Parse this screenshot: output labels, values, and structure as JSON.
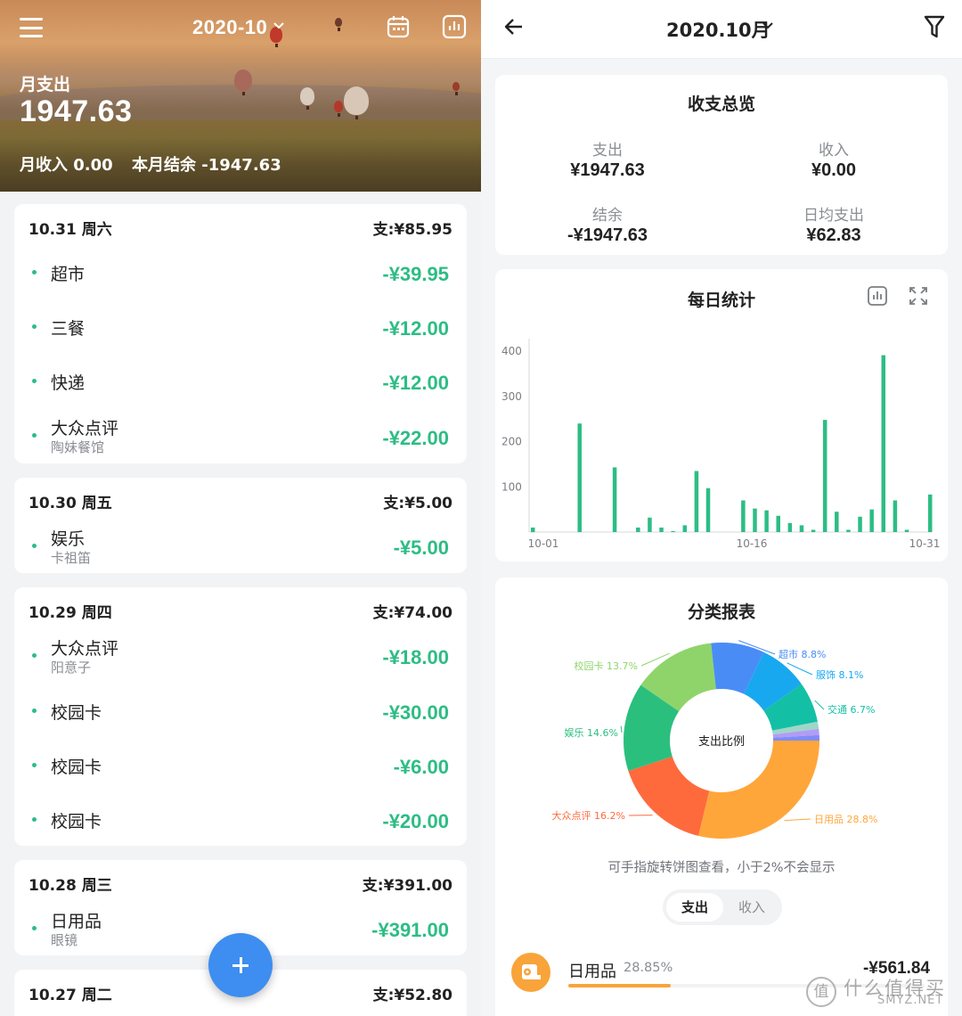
{
  "hero": {
    "month": "2020-10",
    "expense_label": "月支出",
    "expense_value": "1947.63",
    "income_text": "月收入 0.00",
    "balance_text": "本月结余 -1947.63"
  },
  "days": [
    {
      "date": "10.31 周六",
      "total": "支:¥85.95",
      "items": [
        {
          "name": "超市",
          "sub": "",
          "amount": "-¥39.95"
        },
        {
          "name": "三餐",
          "sub": "",
          "amount": "-¥12.00"
        },
        {
          "name": "快递",
          "sub": "",
          "amount": "-¥12.00"
        },
        {
          "name": "大众点评",
          "sub": "陶妹餐馆",
          "amount": "-¥22.00"
        }
      ]
    },
    {
      "date": "10.30 周五",
      "total": "支:¥5.00",
      "items": [
        {
          "name": "娱乐",
          "sub": "卡祖笛",
          "amount": "-¥5.00"
        }
      ]
    },
    {
      "date": "10.29 周四",
      "total": "支:¥74.00",
      "items": [
        {
          "name": "大众点评",
          "sub": "阳意子",
          "amount": "-¥18.00"
        },
        {
          "name": "校园卡",
          "sub": "",
          "amount": "-¥30.00"
        },
        {
          "name": "校园卡",
          "sub": "",
          "amount": "-¥6.00"
        },
        {
          "name": "校园卡",
          "sub": "",
          "amount": "-¥20.00"
        }
      ]
    },
    {
      "date": "10.28 周三",
      "total": "支:¥391.00",
      "items": [
        {
          "name": "日用品",
          "sub": "眼镜",
          "amount": "-¥391.00"
        }
      ]
    },
    {
      "date": "10.27 周二",
      "total": "支:¥52.80",
      "items": []
    }
  ],
  "right": {
    "title": "2020.10月",
    "overview": {
      "title": "收支总览",
      "expense_label": "支出",
      "expense_value": "¥1947.63",
      "income_label": "收入",
      "income_value": "¥0.00",
      "balance_label": "结余",
      "balance_value": "-¥1947.63",
      "daily_label": "日均支出",
      "daily_value": "¥62.83"
    },
    "daily_title": "每日统计",
    "category_title": "分类报表",
    "pie_center": "支出比例",
    "hint": "可手指旋转饼图查看，小于2%不会显示",
    "toggle_expense": "支出",
    "toggle_income": "收入",
    "top_category": {
      "name": "日用品",
      "pct_text": "28.85%",
      "amount": "-¥561.84",
      "fraction": 0.2885
    }
  },
  "chart_data": [
    {
      "type": "bar",
      "title": "每日统计",
      "x": [
        "10-01",
        "10-02",
        "10-03",
        "10-04",
        "10-05",
        "10-06",
        "10-07",
        "10-08",
        "10-09",
        "10-10",
        "10-11",
        "10-12",
        "10-13",
        "10-14",
        "10-15",
        "10-16",
        "10-17",
        "10-18",
        "10-19",
        "10-20",
        "10-21",
        "10-22",
        "10-23",
        "10-24",
        "10-25",
        "10-26",
        "10-27",
        "10-28",
        "10-29",
        "10-30",
        "10-31"
      ],
      "x_tick_labels": [
        "10-01",
        "10-16",
        "10-31"
      ],
      "values": [
        10,
        0,
        0,
        0,
        240,
        0,
        0,
        143,
        0,
        10,
        32,
        10,
        2,
        15,
        135,
        97,
        0,
        0,
        70,
        52,
        48,
        36,
        20,
        15,
        5,
        248,
        45,
        5,
        34,
        50,
        391,
        70,
        5,
        0,
        83
      ],
      "y_ticks": [
        100,
        200,
        300,
        400
      ],
      "ylim": [
        0,
        430
      ],
      "color": "#2dbd84"
    },
    {
      "type": "pie",
      "title": "分类报表",
      "center_label": "支出比例",
      "slices": [
        {
          "label": "日用品",
          "pct_text": "28.8%",
          "value": 28.8,
          "color": "#ffa63b"
        },
        {
          "label": "大众点评",
          "pct_text": "16.2%",
          "value": 16.2,
          "color": "#ff6a3d"
        },
        {
          "label": "娱乐",
          "pct_text": "14.6%",
          "value": 14.6,
          "color": "#2bbf7e"
        },
        {
          "label": "校园卡",
          "pct_text": "13.7%",
          "value": 13.7,
          "color": "#8fd46a"
        },
        {
          "label": "超市",
          "pct_text": "8.8%",
          "value": 8.8,
          "color": "#4a8cf6"
        },
        {
          "label": "服饰",
          "pct_text": "8.1%",
          "value": 8.1,
          "color": "#18a8f0"
        },
        {
          "label": "交通",
          "pct_text": "6.7%",
          "value": 6.7,
          "color": "#13c0a5"
        },
        {
          "label": "",
          "pct_text": "",
          "value": 1.2,
          "color": "#9fd6c8"
        },
        {
          "label": "",
          "pct_text": "",
          "value": 1.0,
          "color": "#b29cf5"
        },
        {
          "label": "",
          "pct_text": "",
          "value": 0.9,
          "color": "#7f8cf8"
        }
      ]
    }
  ],
  "watermark": {
    "badge": "值",
    "text": "什么值得买",
    "sub": "SMYZ.NET"
  }
}
